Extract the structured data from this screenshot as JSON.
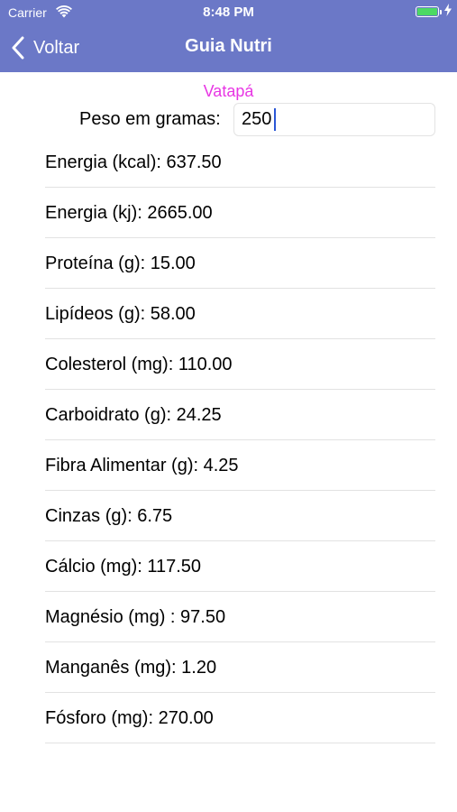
{
  "status_bar": {
    "carrier": "Carrier",
    "time": "8:48 PM",
    "battery_color": "#4cd964",
    "icons": [
      "wifi-icon",
      "battery-icon",
      "charging-bolt-icon"
    ]
  },
  "nav": {
    "back_label": "Voltar",
    "title": "Guia Nutri",
    "bar_color": "#6b78c7"
  },
  "food": {
    "name": "Vatapá",
    "name_color": "#e836e4"
  },
  "weight": {
    "label": "Peso em gramas:",
    "value": "250"
  },
  "nutrients": [
    "Energia (kcal): 637.50",
    "Energia (kj): 2665.00",
    "Proteína (g): 15.00",
    "Lipídeos (g): 58.00",
    "Colesterol (mg): 110.00",
    "Carboidrato (g): 24.25",
    "Fibra Alimentar (g): 4.25",
    "Cinzas (g): 6.75",
    "Cálcio (mg): 117.50",
    "Magnésio (mg) : 97.50",
    "Manganês (mg): 1.20",
    "Fósforo (mg): 270.00"
  ]
}
